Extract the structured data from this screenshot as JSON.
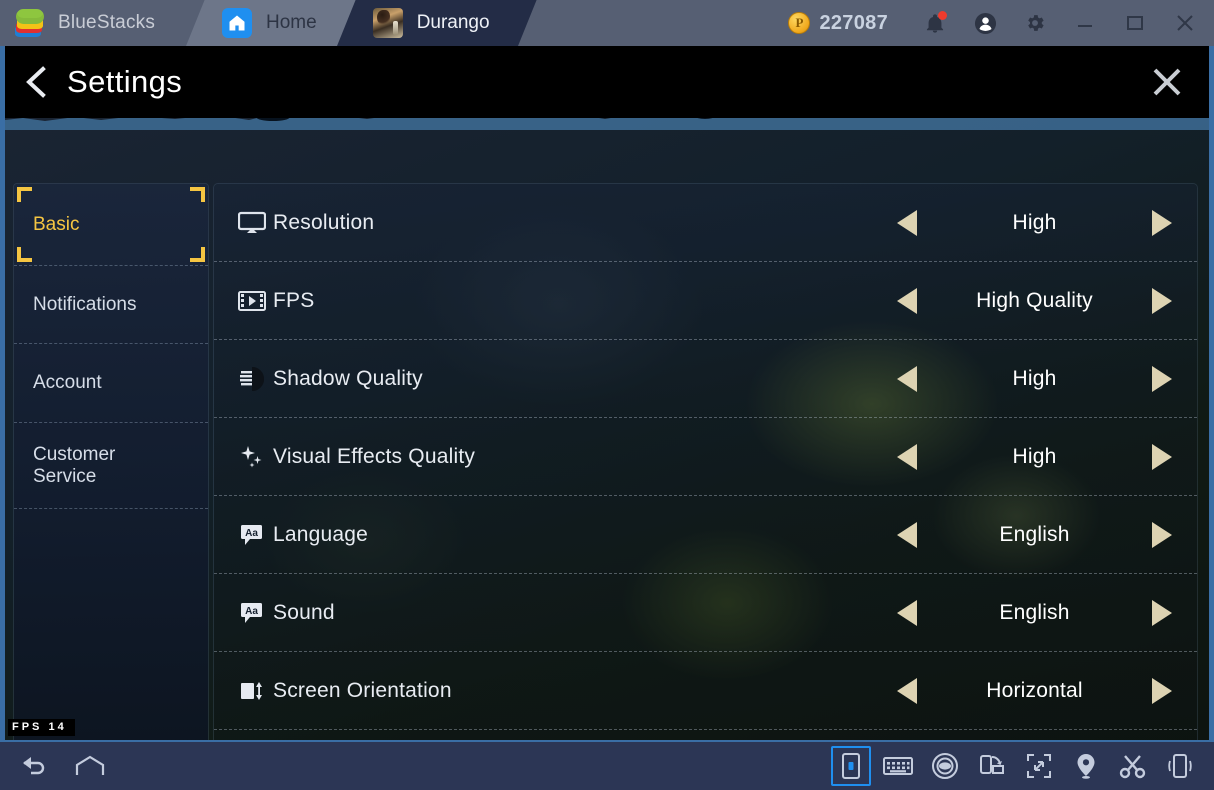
{
  "titlebar": {
    "brand": "BlueStacks",
    "brand_logo_icon": "bluestacks-logo-icon",
    "tabs": [
      {
        "label": "Home",
        "icon": "home-icon",
        "active": false
      },
      {
        "label": "Durango",
        "icon": "durango-app-icon",
        "active": true
      }
    ],
    "coins": {
      "icon": "coin-icon",
      "amount": "227087"
    },
    "actions": [
      {
        "name": "notifications-button",
        "icon": "bell-icon",
        "badge": true
      },
      {
        "name": "account-button",
        "icon": "user-avatar-icon"
      },
      {
        "name": "settings-button",
        "icon": "gear-icon"
      }
    ],
    "window_controls": [
      {
        "name": "minimize-button",
        "icon": "minimize-icon"
      },
      {
        "name": "maximize-button",
        "icon": "maximize-icon"
      },
      {
        "name": "close-button",
        "icon": "close-icon"
      }
    ]
  },
  "settings": {
    "back_icon": "chevron-left-icon",
    "title": "Settings",
    "close_icon": "close-icon",
    "sidebar": [
      {
        "label": "Basic",
        "selected": true
      },
      {
        "label": "Notifications",
        "selected": false
      },
      {
        "label": "Account",
        "selected": false
      },
      {
        "label": "Customer\nService",
        "selected": false
      }
    ],
    "rows": [
      {
        "icon": "monitor-icon",
        "label": "Resolution",
        "value": "High"
      },
      {
        "icon": "film-icon",
        "label": "FPS",
        "value": "High Quality"
      },
      {
        "icon": "contrast-icon",
        "label": "Shadow Quality",
        "value": "High"
      },
      {
        "icon": "sparkles-icon",
        "label": "Visual Effects Quality",
        "value": "High"
      },
      {
        "icon": "text-bubble-icon",
        "label": "Language",
        "value": "English"
      },
      {
        "icon": "text-bubble-icon",
        "label": "Sound",
        "value": "English"
      },
      {
        "icon": "orientation-icon",
        "label": "Screen Orientation",
        "value": "Horizontal"
      }
    ],
    "arrow_left_icon": "arrow-left-icon",
    "arrow_right_icon": "arrow-right-icon"
  },
  "fps_counter": "FPS  14",
  "bottombar": {
    "left": [
      {
        "name": "back-button",
        "icon": "back-arrow-icon"
      },
      {
        "name": "home-button",
        "icon": "home-outline-icon"
      }
    ],
    "right": [
      {
        "name": "vertical-key-mapping-button",
        "icon": "phone-key-icon",
        "selected": true
      },
      {
        "name": "keyboard-controls-button",
        "icon": "keyboard-icon",
        "selected": false
      },
      {
        "name": "eye-button",
        "icon": "eye-icon",
        "selected": false
      },
      {
        "name": "rotate-button",
        "icon": "rotate-screen-icon",
        "selected": false
      },
      {
        "name": "fullscreen-button",
        "icon": "fullscreen-icon",
        "selected": false
      },
      {
        "name": "location-button",
        "icon": "location-pin-icon",
        "selected": false
      },
      {
        "name": "cut-button",
        "icon": "scissors-icon",
        "selected": false
      },
      {
        "name": "shake-button",
        "icon": "shake-device-icon",
        "selected": false
      }
    ]
  },
  "colors": {
    "titlebar_bg": "#565f73",
    "accent_blue": "#1f8ff0",
    "selected_yellow": "#f5c542",
    "arrow_tan": "#ddd3b2",
    "bottombar_bg": "#2c3655",
    "screen_border": "#3a6ea5"
  }
}
